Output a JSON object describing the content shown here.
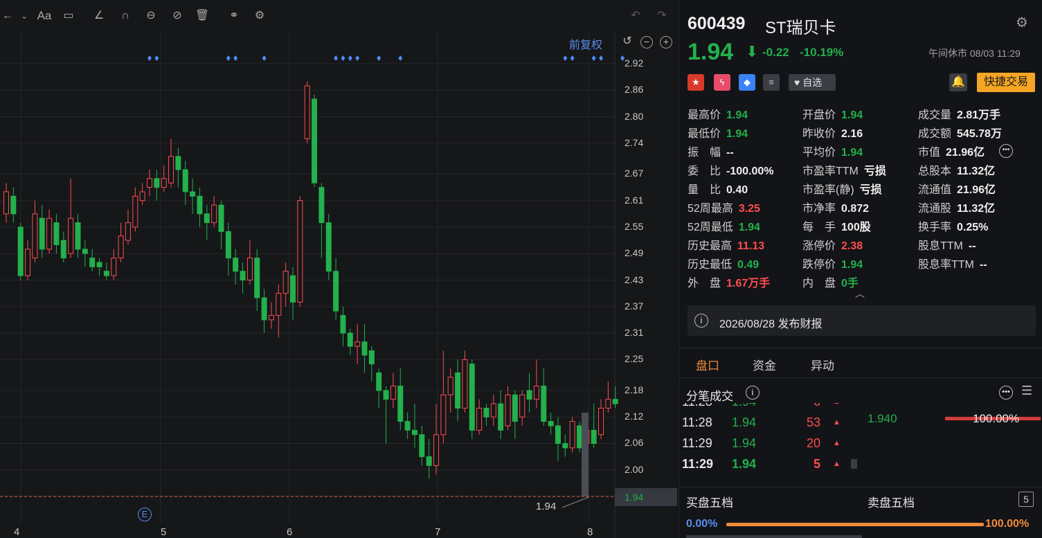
{
  "toolbar": {
    "icons": [
      "back-arrow-icon",
      "text-size-icon",
      "comment-icon",
      "line-draw-icon",
      "magnet-icon",
      "measure-icon",
      "hide-drawings-icon",
      "trash-icon",
      "compare-icon",
      "settings-icon",
      "undo-icon",
      "redo-icon"
    ],
    "text_size_label": "Aa"
  },
  "chart": {
    "adjust_label": "前复权",
    "last_price_tag": "1.94",
    "last_price_callout": "1.94",
    "event_badge": "E"
  },
  "chart_data": {
    "type": "candlestick",
    "ylim": [
      1.9,
      2.95
    ],
    "yticks": [
      "2.92",
      "2.86",
      "2.80",
      "2.74",
      "2.67",
      "2.61",
      "2.55",
      "2.49",
      "2.43",
      "2.37",
      "2.31",
      "2.25",
      "2.18",
      "2.12",
      "2.06",
      "2.00",
      "1.94"
    ],
    "xticks": [
      "4",
      "5",
      "6",
      "7",
      "8"
    ],
    "reference_line": 1.94,
    "candles": [
      [
        2.58,
        2.63,
        2.56,
        2.65
      ],
      [
        2.62,
        2.58,
        2.56,
        2.64
      ],
      [
        2.55,
        2.44,
        2.43,
        2.56
      ],
      [
        2.44,
        2.5,
        2.43,
        2.52
      ],
      [
        2.48,
        2.58,
        2.47,
        2.61
      ],
      [
        2.57,
        2.5,
        2.48,
        2.6
      ],
      [
        2.5,
        2.57,
        2.49,
        2.59
      ],
      [
        2.56,
        2.51,
        2.49,
        2.58
      ],
      [
        2.52,
        2.48,
        2.47,
        2.54
      ],
      [
        2.49,
        2.57,
        2.48,
        2.66
      ],
      [
        2.56,
        2.5,
        2.48,
        2.58
      ],
      [
        2.5,
        2.49,
        2.46,
        2.52
      ],
      [
        2.48,
        2.46,
        2.45,
        2.5
      ],
      [
        2.47,
        2.46,
        2.44,
        2.48
      ],
      [
        2.45,
        2.44,
        2.43,
        2.47
      ],
      [
        2.44,
        2.48,
        2.43,
        2.5
      ],
      [
        2.48,
        2.53,
        2.47,
        2.56
      ],
      [
        2.52,
        2.56,
        2.51,
        2.59
      ],
      [
        2.55,
        2.62,
        2.54,
        2.64
      ],
      [
        2.61,
        2.63,
        2.6,
        2.65
      ],
      [
        2.64,
        2.66,
        2.62,
        2.68
      ],
      [
        2.66,
        2.64,
        2.61,
        2.68
      ],
      [
        2.64,
        2.66,
        2.63,
        2.69
      ],
      [
        2.65,
        2.71,
        2.64,
        2.75
      ],
      [
        2.71,
        2.68,
        2.64,
        2.73
      ],
      [
        2.68,
        2.63,
        2.6,
        2.7
      ],
      [
        2.63,
        2.62,
        2.58,
        2.66
      ],
      [
        2.62,
        2.58,
        2.55,
        2.64
      ],
      [
        2.58,
        2.56,
        2.52,
        2.6
      ],
      [
        2.56,
        2.6,
        2.55,
        2.62
      ],
      [
        2.6,
        2.54,
        2.5,
        2.61
      ],
      [
        2.54,
        2.48,
        2.44,
        2.56
      ],
      [
        2.48,
        2.45,
        2.42,
        2.5
      ],
      [
        2.45,
        2.43,
        2.4,
        2.47
      ],
      [
        2.43,
        2.48,
        2.42,
        2.52
      ],
      [
        2.48,
        2.39,
        2.36,
        2.5
      ],
      [
        2.39,
        2.34,
        2.31,
        2.41
      ],
      [
        2.34,
        2.35,
        2.32,
        2.38
      ],
      [
        2.35,
        2.4,
        2.3,
        2.42
      ],
      [
        2.4,
        2.45,
        2.37,
        2.47
      ],
      [
        2.44,
        2.38,
        2.34,
        2.46
      ],
      [
        2.38,
        2.61,
        2.37,
        2.62
      ],
      [
        2.75,
        2.87,
        2.74,
        2.88
      ],
      [
        2.84,
        2.65,
        2.64,
        2.85
      ],
      [
        2.64,
        2.56,
        2.48,
        2.65
      ],
      [
        2.56,
        2.45,
        2.43,
        2.58
      ],
      [
        2.45,
        2.36,
        2.34,
        2.48
      ],
      [
        2.35,
        2.31,
        2.28,
        2.37
      ],
      [
        2.31,
        2.28,
        2.26,
        2.32
      ],
      [
        2.28,
        2.29,
        2.24,
        2.33
      ],
      [
        2.29,
        2.26,
        2.22,
        2.33
      ],
      [
        2.27,
        2.24,
        2.2,
        2.28
      ],
      [
        2.22,
        2.18,
        2.14,
        2.23
      ],
      [
        2.18,
        2.16,
        2.06,
        2.19
      ],
      [
        2.16,
        2.19,
        2.14,
        2.22
      ],
      [
        2.19,
        2.11,
        2.09,
        2.23
      ],
      [
        2.11,
        2.09,
        2.07,
        2.13
      ],
      [
        2.09,
        2.08,
        2.05,
        2.15
      ],
      [
        2.08,
        2.03,
        2.01,
        2.1
      ],
      [
        2.03,
        2.01,
        1.98,
        2.07
      ],
      [
        2.01,
        2.08,
        1.99,
        2.15
      ],
      [
        2.08,
        2.17,
        2.06,
        2.27
      ],
      [
        2.17,
        2.21,
        2.13,
        2.23
      ],
      [
        2.22,
        2.14,
        2.11,
        2.25
      ],
      [
        2.14,
        2.25,
        2.13,
        2.27
      ],
      [
        2.24,
        2.09,
        2.07,
        2.25
      ],
      [
        2.09,
        2.14,
        2.08,
        2.16
      ],
      [
        2.14,
        2.12,
        2.1,
        2.15
      ],
      [
        2.12,
        2.15,
        2.1,
        2.17
      ],
      [
        2.15,
        2.09,
        2.07,
        2.18
      ],
      [
        2.1,
        2.17,
        2.09,
        2.19
      ],
      [
        2.17,
        2.11,
        2.07,
        2.18
      ],
      [
        2.12,
        2.17,
        2.1,
        2.18
      ],
      [
        2.18,
        2.16,
        2.13,
        2.22
      ],
      [
        2.16,
        2.19,
        2.14,
        2.25
      ],
      [
        2.19,
        2.11,
        2.1,
        2.23
      ],
      [
        2.11,
        2.1,
        2.08,
        2.13
      ],
      [
        2.1,
        2.06,
        2.02,
        2.12
      ],
      [
        2.06,
        2.05,
        2.03,
        2.08
      ],
      [
        2.05,
        2.11,
        2.04,
        2.12
      ],
      [
        2.1,
        2.05,
        2.04,
        2.11
      ],
      [
        2.06,
        2.09,
        2.05,
        2.1
      ],
      [
        2.09,
        2.06,
        2.05,
        2.15
      ],
      [
        2.08,
        2.14,
        2.07,
        2.16
      ],
      [
        2.14,
        2.16,
        2.13,
        2.2
      ],
      [
        2.16,
        2.15,
        2.14,
        2.19
      ]
    ],
    "last_bar": [
      2.13,
      1.94,
      1.94,
      2.13
    ],
    "markers_at_index": [
      20,
      21,
      31,
      32,
      36,
      46,
      47,
      48,
      49,
      52,
      55,
      78,
      79,
      82,
      83,
      86
    ]
  },
  "stock": {
    "code": "600439",
    "name": "ST瑞贝卡",
    "price": "1.94",
    "change": "-0.22",
    "change_pct": "-10.19%",
    "status_time": "午间休市 08/03 11:29",
    "watch_label": "自选",
    "quick_trade_label": "快捷交易"
  },
  "stats": [
    {
      "label": "最高价",
      "value": "1.94",
      "color": "green"
    },
    {
      "label": "开盘价",
      "value": "1.94",
      "color": "green"
    },
    {
      "label": "成交量",
      "value": "2.81万手",
      "color": "white"
    },
    {
      "label": "最低价",
      "value": "1.94",
      "color": "green"
    },
    {
      "label": "昨收价",
      "value": "2.16",
      "color": "white"
    },
    {
      "label": "成交额",
      "value": "545.78万",
      "color": "white"
    },
    {
      "label": "振　幅",
      "value": "--",
      "color": "white"
    },
    {
      "label": "平均价",
      "value": "1.94",
      "color": "green"
    },
    {
      "label": "市值",
      "value": "21.96亿",
      "color": "white"
    },
    {
      "label": "委　比",
      "value": "-100.00%",
      "color": "white"
    },
    {
      "label": "市盈率TTM",
      "value": "亏损",
      "color": "white"
    },
    {
      "label": "总股本",
      "value": "11.32亿",
      "color": "white"
    },
    {
      "label": "量　比",
      "value": "0.40",
      "color": "white"
    },
    {
      "label": "市盈率(静)",
      "value": "亏损",
      "color": "white"
    },
    {
      "label": "流通值",
      "value": "21.96亿",
      "color": "white"
    },
    {
      "label": "52周最高",
      "value": "3.25",
      "color": "red"
    },
    {
      "label": "市净率",
      "value": "0.872",
      "color": "white"
    },
    {
      "label": "流通股",
      "value": "11.32亿",
      "color": "white"
    },
    {
      "label": "52周最低",
      "value": "1.94",
      "color": "green"
    },
    {
      "label": "每　手",
      "value": "100股",
      "color": "white"
    },
    {
      "label": "换手率",
      "value": "0.25%",
      "color": "white"
    },
    {
      "label": "历史最高",
      "value": "11.13",
      "color": "red"
    },
    {
      "label": "涨停价",
      "value": "2.38",
      "color": "red"
    },
    {
      "label": "股息TTM",
      "value": "--",
      "color": "white"
    },
    {
      "label": "历史最低",
      "value": "0.49",
      "color": "green"
    },
    {
      "label": "跌停价",
      "value": "1.94",
      "color": "green"
    },
    {
      "label": "股息率TTM",
      "value": "--",
      "color": "white"
    },
    {
      "label": "外　盘",
      "value": "1.67万手",
      "color": "red"
    },
    {
      "label": "内　盘",
      "value": "0手",
      "color": "green"
    }
  ],
  "report": {
    "text": "2026/08/28  发布财报"
  },
  "tabs": [
    "盘口",
    "资金",
    "异动"
  ],
  "ticks": {
    "title": "分笔成交",
    "rows": [
      {
        "time": "11:28",
        "price": "1.94",
        "vol": "6"
      },
      {
        "time": "11:28",
        "price": "1.94",
        "vol": "53"
      },
      {
        "time": "11:29",
        "price": "1.94",
        "vol": "20"
      },
      {
        "time": "11:29",
        "price": "1.94",
        "vol": "5"
      }
    ]
  },
  "distribution": {
    "price": "1.940",
    "pct": "100.00%"
  },
  "book": {
    "buy_label": "买盘五档",
    "sell_label": "卖盘五档",
    "depth": "5",
    "buy_pct": "0.00%",
    "sell_pct": "100.00%"
  },
  "colors": {
    "up": "#ff4d4f",
    "down": "#22b14c",
    "accent": "#f08b3a",
    "link": "#5a8df0"
  }
}
